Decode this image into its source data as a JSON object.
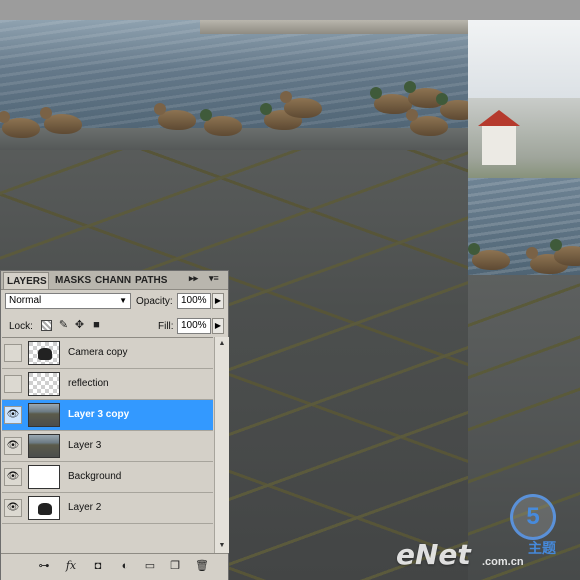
{
  "panel": {
    "tabs": [
      {
        "label": "LAYERS",
        "active": true
      },
      {
        "label": "MASKS",
        "active": false
      },
      {
        "label": "CHANN",
        "active": false
      },
      {
        "label": "PATHS",
        "active": false
      }
    ],
    "tab_arrows": "▸▸",
    "tab_menu": "▾≡",
    "blend_mode": "Normal",
    "opacity_label": "Opacity:",
    "opacity_value": "100%",
    "lock_label": "Lock:",
    "fill_label": "Fill:",
    "fill_value": "100%",
    "layers": [
      {
        "name": "Camera copy",
        "visible": false,
        "thumbnail": "checker-silhouette",
        "selected": false
      },
      {
        "name": "reflection",
        "visible": false,
        "thumbnail": "checker",
        "selected": false
      },
      {
        "name": "Layer 3 copy",
        "visible": true,
        "thumbnail": "photo",
        "selected": true
      },
      {
        "name": "Layer 3",
        "visible": true,
        "thumbnail": "photo",
        "selected": false
      },
      {
        "name": "Background",
        "visible": true,
        "thumbnail": "white",
        "selected": false
      },
      {
        "name": "Layer 2",
        "visible": true,
        "thumbnail": "white-silhouette",
        "selected": false
      }
    ],
    "footer_icons": [
      "link-icon",
      "fx-icon",
      "mask-icon",
      "adjustment-icon",
      "folder-icon",
      "new-layer-icon",
      "trash-icon"
    ]
  },
  "watermark": {
    "brand": "eNet",
    "badge": "5",
    "domain": ".com.cn",
    "cn": "主题"
  },
  "colors": {
    "selection": "#3399ff",
    "panel_bg": "#d4d0c8"
  }
}
